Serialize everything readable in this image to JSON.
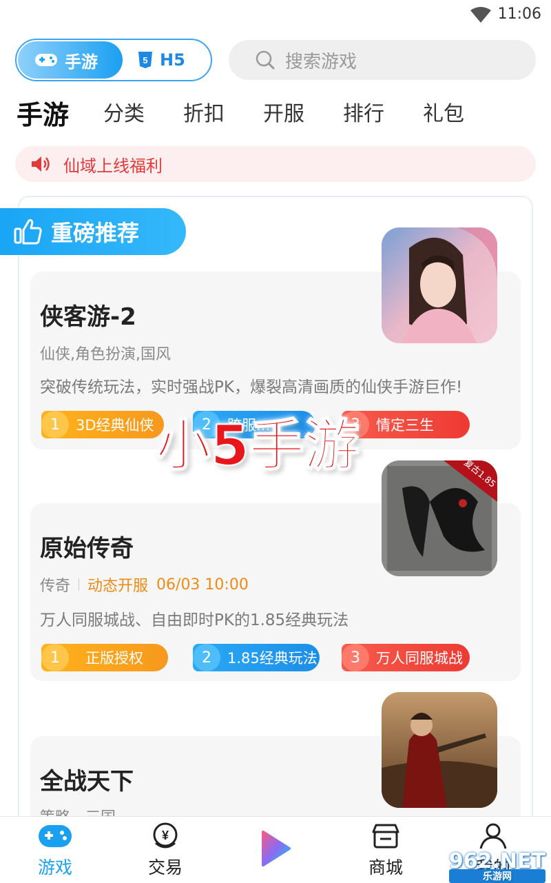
{
  "status": {
    "time": "11:06",
    "wifi_icon": "wifi-icon"
  },
  "toggle": {
    "mobile_label": "手游",
    "h5_label": "H5"
  },
  "search": {
    "placeholder": "搜索游戏"
  },
  "tabs": [
    {
      "label": "手游",
      "active": true
    },
    {
      "label": "分类"
    },
    {
      "label": "折扣"
    },
    {
      "label": "开服"
    },
    {
      "label": "排行"
    },
    {
      "label": "礼包"
    }
  ],
  "notice": {
    "text": "仙域上线福利",
    "icon": "speaker-icon"
  },
  "banner": {
    "title": "重磅推荐",
    "icon": "thumbs-up-icon"
  },
  "games": [
    {
      "name": "侠客游-2",
      "tags": "仙侠,角色扮演,国风",
      "desc": "突破传统玩法，实时强战PK，爆裂高清画质的仙侠手游巨作!",
      "pills": [
        {
          "num": "1",
          "label": "3D经典仙侠"
        },
        {
          "num": "2",
          "label": "跨服..."
        },
        {
          "num": "3",
          "label": "情定三生"
        }
      ]
    },
    {
      "name": "原始传奇",
      "tags": "传奇",
      "open_label": "动态开服",
      "open_time": "06/03 10:00",
      "desc": "万人同服城战、自由即时PK的1.85经典玩法",
      "badge": "复古1.85",
      "pills": [
        {
          "num": "1",
          "label": "正版授权"
        },
        {
          "num": "2",
          "label": "1.85经典玩法"
        },
        {
          "num": "3",
          "label": "万人同服城战"
        }
      ]
    },
    {
      "name": "全战天下",
      "tags": "策略，三国"
    }
  ],
  "watermark": "小5手游",
  "bottom_nav": [
    {
      "label": "游戏",
      "icon": "gamepad-icon",
      "active": true
    },
    {
      "label": "交易",
      "icon": "trade-icon"
    },
    {
      "label": "",
      "icon": "play-icon"
    },
    {
      "label": "商城",
      "icon": "store-icon"
    },
    {
      "label": "我的",
      "icon": "user-icon"
    }
  ],
  "site_logo": {
    "main": "962.NET",
    "sub": "乐游网"
  },
  "colors": {
    "accent": "#1aa0f1",
    "notice_red": "#e03a3a",
    "open_orange": "#ef8a13"
  }
}
